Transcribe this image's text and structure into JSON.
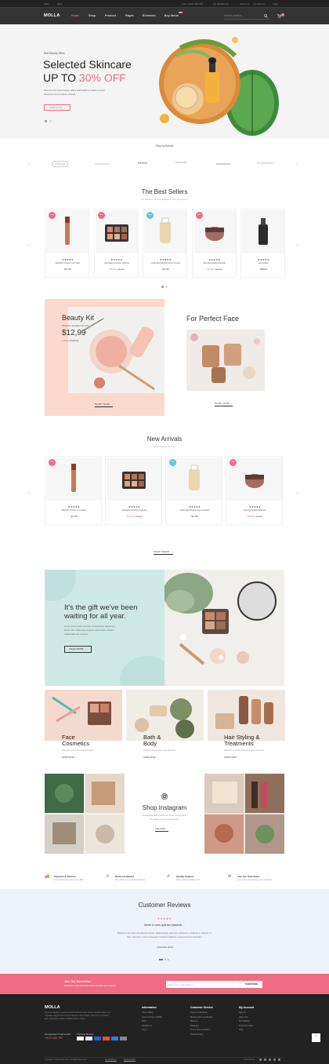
{
  "topbar": {
    "currency": "USD",
    "language": "ENG",
    "phone": "Call: +0123 456 789",
    "wishlist": "My Wishlist (3)",
    "about": "About Us",
    "contact": "Contact Us",
    "login": "Login"
  },
  "header": {
    "logo": "MOLLA",
    "nav": [
      "Home",
      "Shop",
      "Product",
      "Pages",
      "Elements",
      "Buy Molla"
    ],
    "nav_badge": "Hot",
    "search_placeholder": "Search product ...",
    "cart_count": "2"
  },
  "hero": {
    "eyebrow": "Best Beauty Offers",
    "title_line1": "Selected Skincare",
    "title_line2_prefix": "UP TO ",
    "title_line2_highlight": "30% OFF",
    "desc_line1": "Discover the best beauty offers and treats on some of your",
    "desc_line2": "favourite luxury beauty brands",
    "button": "SHOP NOW →"
  },
  "brands": {
    "title": "Shop by Brands",
    "items": [
      "VINTAGE",
      "BLACK STAR",
      "HUGO",
      "MOUNTAIN",
      "DRESSROOM",
      "LE BANNEL"
    ]
  },
  "best_sellers": {
    "title": "The Best Sellers",
    "subtitle": "The World's Premium Brands In One Destination.",
    "products": [
      {
        "badge": "Sale",
        "name": "Benefit® Cheek & Lip Stain",
        "stars": "★★★★★",
        "price": "$17.99",
        "old": ""
      },
      {
        "badge": "Sale",
        "name": "Hourglass Ambient Lighting",
        "stars": "★★★★★",
        "price": "$15.99",
        "old": "$21.99"
      },
      {
        "badge": "New",
        "name": "Under Eye Brightening Corrector",
        "stars": "★★★★★",
        "price": "$17.99",
        "old": ""
      },
      {
        "badge": "Sale",
        "name": "Eco Eyeshadow Blender",
        "stars": "★★★★★",
        "price": "$15.99",
        "old": "$21.99"
      },
      {
        "badge": "",
        "name": "Encounter",
        "stars": "★★★★★",
        "price": "$28.50",
        "old": ""
      }
    ]
  },
  "promo": {
    "beauty_title": "Beauty Kit",
    "beauty_sub": "5 Deluxe samples for only",
    "beauty_price": "$12,99",
    "beauty_ship": "+ Free Shipping",
    "beauty_button": "SHOP NOW →",
    "face_title": "For Perfect Face",
    "face_button": "SHOP NOW →"
  },
  "new_arrivals": {
    "title": "New Arrivals",
    "subtitle": "Fresh Beauty For You",
    "view_more": "VIEW MORE →",
    "products": [
      {
        "badge": "Sale",
        "name": "Benefit® Cheek & Lip Stain",
        "stars": "★★★★★",
        "price": "$17.99",
        "old": ""
      },
      {
        "badge": "",
        "name": "Hourglass Ambient Lighting",
        "stars": "★★★★★",
        "price": "$15.99",
        "old": "$21.99"
      },
      {
        "badge": "New",
        "name": "Under Eye Brightening Corrector",
        "stars": "★★★★★",
        "price": "$17.99",
        "old": ""
      },
      {
        "badge": "Sale",
        "name": "Eco Eyeshadow Blender",
        "stars": "★★★★★",
        "price": "$15.99",
        "old": "$21.99"
      }
    ]
  },
  "gift": {
    "line1": "It's the gift we've been",
    "line2": "waiting for all year.",
    "desc_line1": "Lorem ipsum dolor sit amet, consectetuer adipiscing",
    "desc_line2": "Morbi odio. Nulla quis tempus reattyscantis. Nullam",
    "desc_line3": "malesuada erat ut turpis.",
    "button": "READ MORE →"
  },
  "categories": [
    {
      "title1": "Face",
      "title2": "Cosmetics",
      "sub": "The best products for all skin types",
      "link": "SHOP NOW →"
    },
    {
      "title1": "Bath &",
      "title2": "Body",
      "sub": "Products that protect your skin 24/7",
      "link": "SHOP NOW →"
    },
    {
      "title1": "Hair Styling &",
      "title2": "Treatments",
      "sub": "Powerful Formulas that bring your hair to life",
      "link": "SHOP NOW →"
    }
  ],
  "instagram": {
    "title": "Shop Instagram",
    "desc_line1": "Sustainable quam ut dolor ac turpis. Suspendisse",
    "desc_line2": "convallis vel nunc ut fermentum.",
    "button": "FOLLOW →"
  },
  "services": [
    {
      "title": "Payment & Delivery",
      "sub": "Free shipping for orders over $50"
    },
    {
      "title": "Return & Refund",
      "sub": "Free 100% money back guarantee"
    },
    {
      "title": "Quality Support",
      "sub": "Alway online feedback 24/7"
    },
    {
      "title": "Join Our Newsletter",
      "sub": "10% off by subscribing to our newsletter"
    }
  ],
  "reviews": {
    "title": "Customer Reviews",
    "stars": "★★★★★",
    "quote": "Morbi in sem quis dui placerat ...",
    "text_line1": "Mauris in sem quis dui placerat ornare. Pellentesque odio nisi, euismod in, pharetra a, ultricies in,",
    "text_line2": "diam. Sed arcu. Cras consequat. Praesent dapibus, neque id cursus faucibus.",
    "author": "- Samantha Wood"
  },
  "newsletter": {
    "title": "Join Our Newsletter",
    "subtitle": "Subscribe to get information about products and coupons",
    "placeholder": "Enter your email address",
    "button": "SUBSCRIBE"
  },
  "footer": {
    "logo": "MOLLA",
    "about_line1": "Praesent dapibus, neque id cursus ultrices, tortor neque egestas augue, eu",
    "about_line2": "vulputate magna eros eu erat. Aliquam erat volutpat. Nam dui mi, tincidunt",
    "about_line3": "quis, accumsan porttitor, facilisis luctus, metus.",
    "question": "Got Question? Call us 24/7",
    "phone": "+0123 456 789",
    "payment_label": "Payment Method",
    "col1_title": "Information",
    "col1": [
      "About Molla",
      "How to shop on Molla",
      "FAQ",
      "Contact us",
      "Log in"
    ],
    "col2_title": "Customer Service",
    "col2": [
      "Payment Methods",
      "Money-back guarantee!",
      "Returns",
      "Shipping",
      "Terms and conditions",
      "Privacy Policy"
    ],
    "col3_title": "My Account",
    "col3": [
      "Sign In",
      "View Cart",
      "My Wishlist",
      "Track My Order",
      "Help"
    ],
    "copyright": "Copyright © 2019 Molla Store. All Rights Reserved.",
    "terms": "Terms Of Use",
    "privacy": "Privacy Policy",
    "social": "Social Media"
  },
  "colors": {
    "accent": "#ef6c83",
    "dark": "#333333",
    "footer": "#222222",
    "mint": "#cde9e6",
    "peach": "#fbd9cd"
  }
}
